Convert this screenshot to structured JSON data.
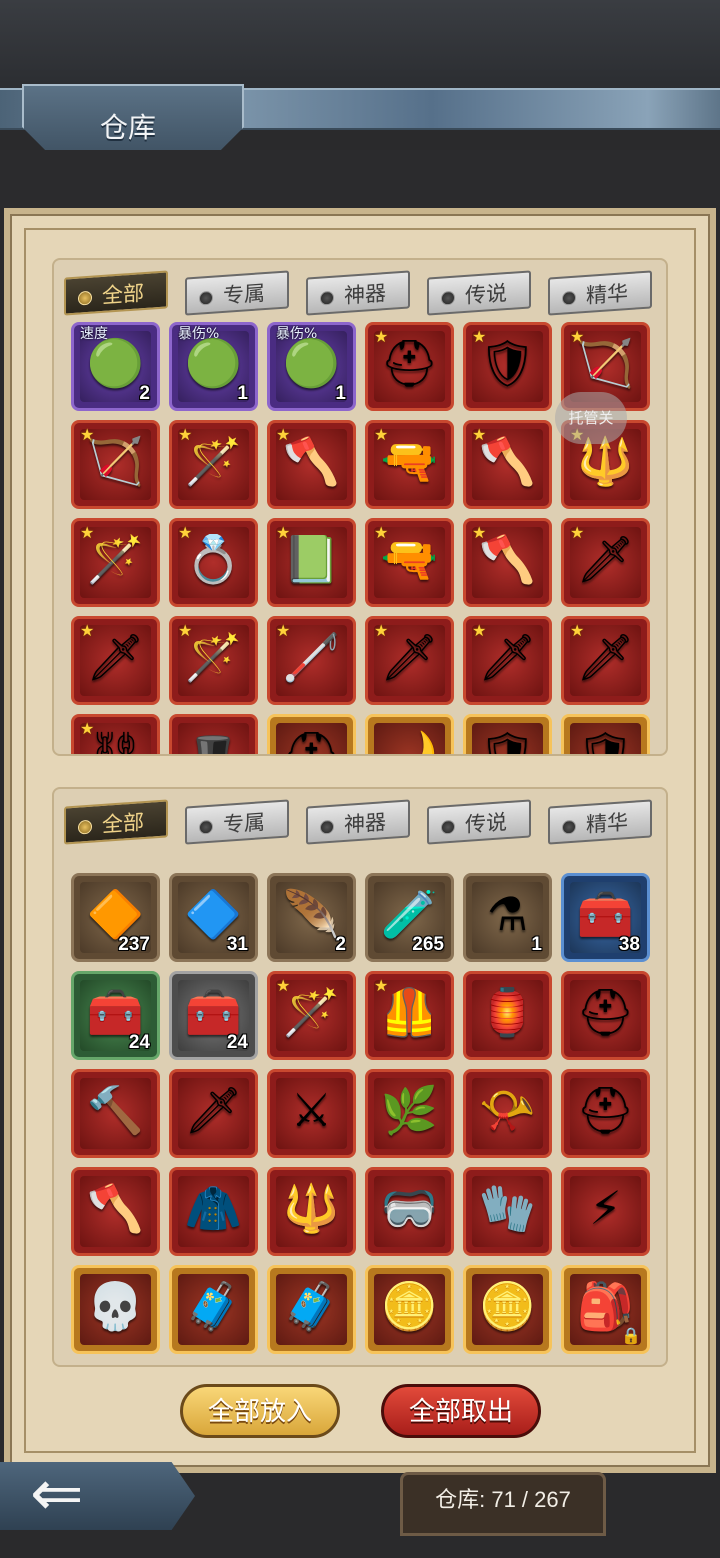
{
  "header": {
    "title": "仓库"
  },
  "tabs_top": [
    {
      "label": "全部",
      "active": true
    },
    {
      "label": "专属",
      "active": false
    },
    {
      "label": "神器",
      "active": false
    },
    {
      "label": "传说",
      "active": false
    },
    {
      "label": "精华",
      "active": false
    }
  ],
  "tabs_bottom": [
    {
      "label": "全部",
      "active": true
    },
    {
      "label": "专属",
      "active": false
    },
    {
      "label": "神器",
      "active": false
    },
    {
      "label": "传说",
      "active": false
    },
    {
      "label": "精华",
      "active": false
    }
  ],
  "floating_helper": {
    "label": "托管关"
  },
  "top_items": [
    {
      "name": "speed-gem",
      "icon": "green-gem-icon",
      "glyph": "🟢",
      "rarity": "purple",
      "label": "速度",
      "count": "2"
    },
    {
      "name": "crit-gem-1",
      "icon": "green-gem-icon",
      "glyph": "🟢",
      "rarity": "purple",
      "label": "暴伤%",
      "count": "1"
    },
    {
      "name": "crit-gem-2",
      "icon": "green-gem-icon",
      "glyph": "🟢",
      "rarity": "purple",
      "label": "暴伤%",
      "count": "1"
    },
    {
      "name": "dark-helm",
      "icon": "helmet-icon",
      "glyph": "⛑",
      "rarity": "red",
      "star": true
    },
    {
      "name": "shield",
      "icon": "shield-icon",
      "glyph": "🛡",
      "rarity": "red",
      "star": true
    },
    {
      "name": "bow",
      "icon": "bow-icon",
      "glyph": "🏹",
      "rarity": "red",
      "star": true
    },
    {
      "name": "crossbow",
      "icon": "crossbow-icon",
      "glyph": "🏹",
      "rarity": "red",
      "star": true
    },
    {
      "name": "staff",
      "icon": "staff-icon",
      "glyph": "🪄",
      "rarity": "red",
      "star": true
    },
    {
      "name": "axe",
      "icon": "axe-icon",
      "glyph": "🪓",
      "rarity": "red",
      "star": true
    },
    {
      "name": "rifle",
      "icon": "gun-icon",
      "glyph": "🔫",
      "rarity": "red",
      "star": true
    },
    {
      "name": "fire-axe",
      "icon": "axe-icon",
      "glyph": "🪓",
      "rarity": "red",
      "star": true
    },
    {
      "name": "spear",
      "icon": "spear-icon",
      "glyph": "🔱",
      "rarity": "red",
      "star": true
    },
    {
      "name": "orb-wand",
      "icon": "wand-icon",
      "glyph": "🪄",
      "rarity": "red",
      "star": true
    },
    {
      "name": "ring",
      "icon": "ring-icon",
      "glyph": "💍",
      "rarity": "red",
      "star": true
    },
    {
      "name": "spellbook",
      "icon": "book-icon",
      "glyph": "📗",
      "rarity": "red",
      "star": true
    },
    {
      "name": "pistol",
      "icon": "gun-icon",
      "glyph": "🔫",
      "rarity": "red",
      "star": true
    },
    {
      "name": "double-axe",
      "icon": "axe-icon",
      "glyph": "🪓",
      "rarity": "red",
      "star": true
    },
    {
      "name": "rapier",
      "icon": "sword-icon",
      "glyph": "🗡",
      "rarity": "red",
      "star": true
    },
    {
      "name": "rapier-2",
      "icon": "sword-icon",
      "glyph": "🗡",
      "rarity": "red",
      "star": true
    },
    {
      "name": "scepter",
      "icon": "scepter-icon",
      "glyph": "🪄",
      "rarity": "red",
      "star": true
    },
    {
      "name": "cane",
      "icon": "cane-icon",
      "glyph": "🦯",
      "rarity": "red",
      "star": true
    },
    {
      "name": "lance-1",
      "icon": "lance-icon",
      "glyph": "🗡",
      "rarity": "red",
      "star": true
    },
    {
      "name": "lance-2",
      "icon": "lance-icon",
      "glyph": "🗡",
      "rarity": "red",
      "star": true
    },
    {
      "name": "lance-3",
      "icon": "lance-icon",
      "glyph": "🗡",
      "rarity": "red",
      "star": true
    },
    {
      "name": "chain-item",
      "icon": "chain-icon",
      "glyph": "⛓",
      "rarity": "red",
      "star": true
    },
    {
      "name": "red-hat",
      "icon": "hat-icon",
      "glyph": "🎩",
      "rarity": "red"
    },
    {
      "name": "gold-helm",
      "icon": "helmet-icon",
      "glyph": "⛑",
      "rarity": "gold"
    },
    {
      "name": "gold-scythe",
      "icon": "scythe-icon",
      "glyph": "🌙",
      "rarity": "gold"
    },
    {
      "name": "gold-shield-1",
      "icon": "shield-icon",
      "glyph": "🛡",
      "rarity": "gold"
    },
    {
      "name": "gold-shield-2",
      "icon": "shield-icon",
      "glyph": "🛡",
      "rarity": "gold"
    }
  ],
  "bottom_items": [
    {
      "name": "rune-stone",
      "icon": "rune-icon",
      "glyph": "🔶",
      "rarity": "brown",
      "count": "237"
    },
    {
      "name": "soul-stone",
      "icon": "soul-icon",
      "glyph": "🔷",
      "rarity": "brown",
      "count": "31"
    },
    {
      "name": "feather",
      "icon": "feather-icon",
      "glyph": "🪶",
      "rarity": "brown",
      "count": "2"
    },
    {
      "name": "potion-large",
      "icon": "potion-icon",
      "glyph": "🧪",
      "rarity": "brown",
      "count": "265"
    },
    {
      "name": "potion-small",
      "icon": "potion-icon",
      "glyph": "⚗",
      "rarity": "brown",
      "count": "1"
    },
    {
      "name": "chest-blue",
      "icon": "chest-icon",
      "glyph": "🧰",
      "rarity": "blue",
      "count": "38"
    },
    {
      "name": "chest-green",
      "icon": "chest-icon",
      "glyph": "🧰",
      "rarity": "green",
      "count": "24"
    },
    {
      "name": "chest-gray",
      "icon": "chest-icon",
      "glyph": "🧰",
      "rarity": "gray",
      "count": "24"
    },
    {
      "name": "staff",
      "icon": "staff-icon",
      "glyph": "🪄",
      "rarity": "red",
      "star": true
    },
    {
      "name": "armor",
      "icon": "armor-icon",
      "glyph": "🦺",
      "rarity": "red",
      "star": true
    },
    {
      "name": "lantern",
      "icon": "lantern-icon",
      "glyph": "🏮",
      "rarity": "red"
    },
    {
      "name": "hood",
      "icon": "hood-icon",
      "glyph": "⛑",
      "rarity": "red"
    },
    {
      "name": "hammer",
      "icon": "hammer-icon",
      "glyph": "🔨",
      "rarity": "red"
    },
    {
      "name": "dagger",
      "icon": "dagger-icon",
      "glyph": "🗡",
      "rarity": "red"
    },
    {
      "name": "sword",
      "icon": "sword-icon",
      "glyph": "⚔",
      "rarity": "red"
    },
    {
      "name": "green-blade",
      "icon": "blade-icon",
      "glyph": "🌿",
      "rarity": "red"
    },
    {
      "name": "horn",
      "icon": "horn-icon",
      "glyph": "📯",
      "rarity": "red"
    },
    {
      "name": "knight-helm",
      "icon": "helmet-icon",
      "glyph": "⛑",
      "rarity": "red"
    },
    {
      "name": "war-axe",
      "icon": "axe-icon",
      "glyph": "🪓",
      "rarity": "red"
    },
    {
      "name": "cloak",
      "icon": "cloak-icon",
      "glyph": "🧥",
      "rarity": "red"
    },
    {
      "name": "spear-tip",
      "icon": "spear-icon",
      "glyph": "🔱",
      "rarity": "red"
    },
    {
      "name": "goggles",
      "icon": "goggles-icon",
      "glyph": "🥽",
      "rarity": "red"
    },
    {
      "name": "gauntlet",
      "icon": "gauntlet-icon",
      "glyph": "🧤",
      "rarity": "red"
    },
    {
      "name": "lightning-blade",
      "icon": "lightning-icon",
      "glyph": "⚡",
      "rarity": "red"
    },
    {
      "name": "skull-cape",
      "icon": "skull-icon",
      "glyph": "💀",
      "rarity": "gold"
    },
    {
      "name": "medkit-1",
      "icon": "medkit-icon",
      "glyph": "🧳",
      "rarity": "gold"
    },
    {
      "name": "medkit-2",
      "icon": "medkit-icon",
      "glyph": "🧳",
      "rarity": "gold"
    },
    {
      "name": "winged-amulet-1",
      "icon": "amulet-icon",
      "glyph": "🪙",
      "rarity": "gold"
    },
    {
      "name": "winged-amulet-2",
      "icon": "amulet-icon",
      "glyph": "🪙",
      "rarity": "gold"
    },
    {
      "name": "leather-bag",
      "icon": "bag-icon",
      "glyph": "🎒",
      "rarity": "gold",
      "locked": true
    }
  ],
  "buttons": {
    "store_all": "全部放入",
    "take_all": "全部取出"
  },
  "storage": {
    "label": "仓库: 71 / 267"
  }
}
